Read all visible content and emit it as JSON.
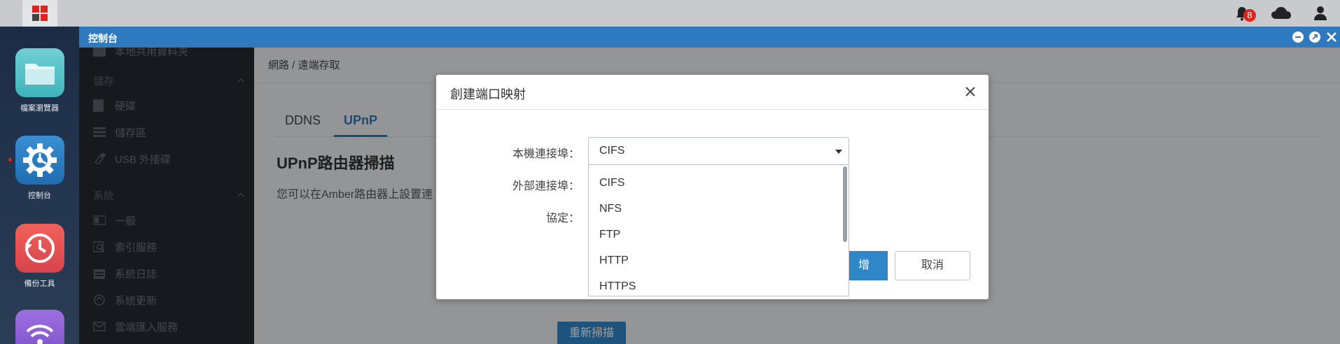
{
  "taskbar": {
    "notification_count": "8"
  },
  "dock": {
    "apps": [
      {
        "label": "檔案瀏覽器",
        "icon": "folder-icon"
      },
      {
        "label": "控制台",
        "icon": "gear-icon"
      },
      {
        "label": "備份工具",
        "icon": "backup-clock-icon"
      },
      {
        "label": "",
        "icon": "wifi-icon"
      }
    ]
  },
  "window": {
    "title": "控制台"
  },
  "sidebar": {
    "partial_top_item": "本地共用資料夾",
    "storage_section": "儲存",
    "storage_items": [
      "硬碟",
      "儲存區",
      "USB 外接碟"
    ],
    "system_section": "系統",
    "system_items": [
      "一般",
      "索引服務",
      "系統日誌",
      "系統更新",
      "雲端匯入服務"
    ]
  },
  "main": {
    "breadcrumb": "網路 / 遠端存取",
    "tabs": [
      {
        "label": "DDNS",
        "active": false
      },
      {
        "label": "UPnP",
        "active": true
      }
    ],
    "section_title": "UPnP路由器掃描",
    "description": "您可以在Amber路由器上設置連",
    "rescan_button": "重新掃描"
  },
  "dialog": {
    "title": "創建端口映射",
    "local_port_label": "本機連接埠：",
    "external_port_label": "外部連接埠：",
    "protocol_label": "協定：",
    "local_port_selected": "CIFS",
    "local_port_options": [
      "CIFS",
      "NFS",
      "FTP",
      "HTTP",
      "HTTPS"
    ],
    "add_button": "新增",
    "add_button_visible": "增",
    "cancel_button": "取消"
  },
  "colors": {
    "accent": "#2f79bf",
    "button_blue": "#2f87c8",
    "badge_red": "#e0241d",
    "sidebar_bg": "#24292f"
  }
}
